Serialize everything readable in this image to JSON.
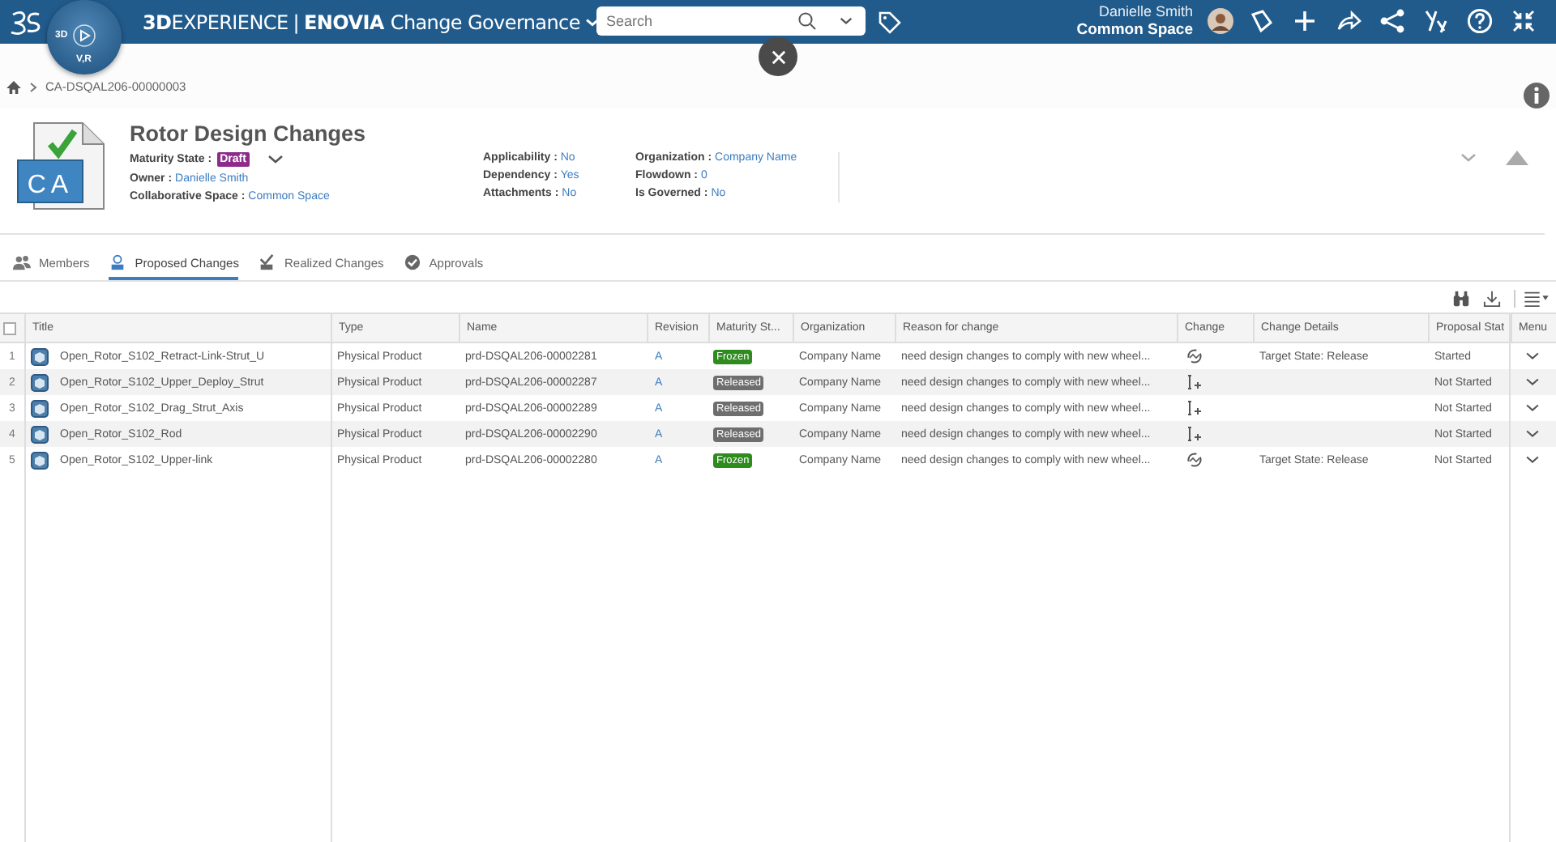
{
  "topbar": {
    "compass_labels": [
      "3D",
      "V,R"
    ],
    "brand_bold": "3D",
    "brand": "EXPERIENCE",
    "separator": "|",
    "app_bold": "ENOVIA",
    "app": "Change Governance",
    "search": {
      "placeholder": "Search"
    },
    "user": "Danielle Smith",
    "space": "Common Space"
  },
  "breadcrumb": "CA-DSQAL206-00000003",
  "header": {
    "badge": "CA",
    "separator": ":",
    "title": "Rotor Design Changes",
    "state": {
      "label": "Maturity State",
      "value": "Draft",
      "color": "#8c2b8c"
    },
    "fields": [
      {
        "label": "Owner",
        "value": "Danielle Smith"
      },
      {
        "label": "Collaborative Space",
        "value": "Common Space"
      }
    ],
    "columns": [
      [
        {
          "label": "Applicability",
          "value": "No"
        },
        {
          "label": "Dependency",
          "value": "Yes"
        },
        {
          "label": "Attachments",
          "value": "No"
        }
      ],
      [
        {
          "label": "Organization",
          "value": "Company Name"
        },
        {
          "label": "Flowdown",
          "value": "0"
        },
        {
          "label": "Is Governed",
          "value": "No"
        }
      ]
    ]
  },
  "tabs": [
    {
      "label": "Members",
      "kind": "members",
      "selected": false
    },
    {
      "label": "Proposed Changes",
      "kind": "proposed",
      "selected": true
    },
    {
      "label": "Realized Changes",
      "kind": "realized",
      "selected": false
    },
    {
      "label": "Approvals",
      "kind": "approvals",
      "selected": false
    }
  ],
  "table": {
    "select_all": {
      "checked": false
    },
    "columns": [
      "Title",
      "Type",
      "Name",
      "Revision",
      "Maturity St...",
      "Organization",
      "Reason for change",
      "Change",
      "Change Details",
      "Proposal Stat",
      "Menu"
    ],
    "rows": [
      {
        "index": "1",
        "title": "Open_Rotor_S102_Retract-Link-Strut_U",
        "type": "Physical Product",
        "name": "prd-DSQAL206-00002281",
        "revision": "A",
        "state": {
          "label": "Frozen",
          "color": "#2e8b1e"
        },
        "organization": "Company Name",
        "reason": "need design changes to comply with new wheel...",
        "kind": "modify",
        "details": "Target State: Release",
        "proposal": "Started"
      },
      {
        "index": "2",
        "title": "Open_Rotor_S102_Upper_Deploy_Strut",
        "type": "Physical Product",
        "name": "prd-DSQAL206-00002287",
        "revision": "A",
        "state": {
          "label": "Released",
          "color": "#6e6e6e"
        },
        "organization": "Company Name",
        "reason": "need design changes to comply with new wheel...",
        "kind": "new",
        "proposal": "Not Started"
      },
      {
        "index": "3",
        "title": "Open_Rotor_S102_Drag_Strut_Axis",
        "type": "Physical Product",
        "name": "prd-DSQAL206-00002289",
        "revision": "A",
        "state": {
          "label": "Released",
          "color": "#6e6e6e"
        },
        "organization": "Company Name",
        "reason": "need design changes to comply with new wheel...",
        "kind": "new",
        "proposal": "Not Started"
      },
      {
        "index": "4",
        "title": "Open_Rotor_S102_Rod",
        "type": "Physical Product",
        "name": "prd-DSQAL206-00002290",
        "revision": "A",
        "state": {
          "label": "Released",
          "color": "#6e6e6e"
        },
        "organization": "Company Name",
        "reason": "need design changes to comply with new wheel...",
        "kind": "new",
        "proposal": "Not Started"
      },
      {
        "index": "5",
        "title": "Open_Rotor_S102_Upper-link",
        "type": "Physical Product",
        "name": "prd-DSQAL206-00002280",
        "revision": "A",
        "state": {
          "label": "Frozen",
          "color": "#2e8b1e"
        },
        "organization": "Company Name",
        "reason": "need design changes to comply with new wheel...",
        "kind": "modify",
        "details": "Target State: Release",
        "proposal": "Not Started"
      }
    ]
  }
}
